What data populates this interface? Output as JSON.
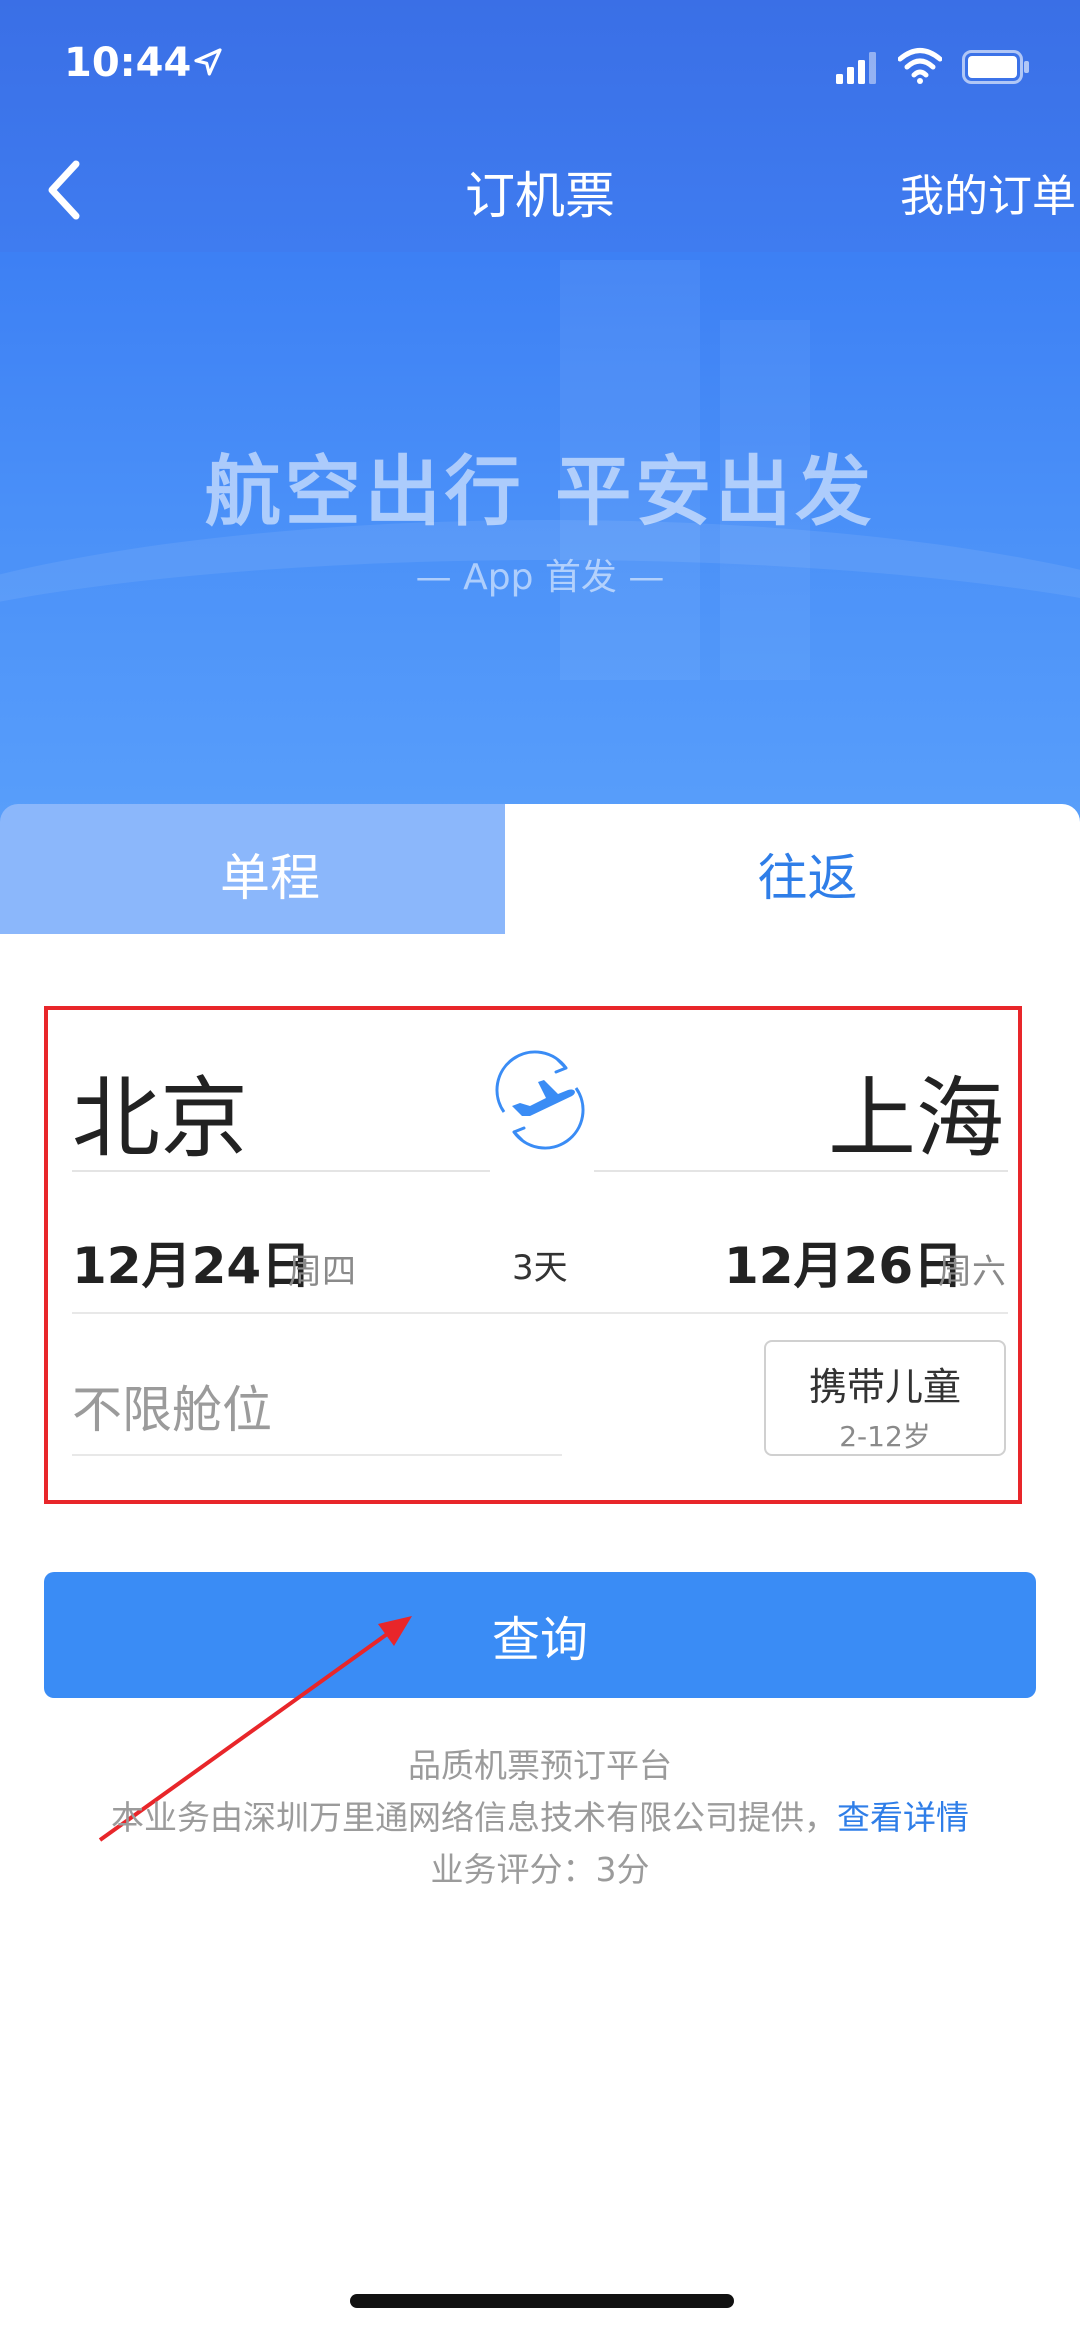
{
  "status_bar": {
    "time": "10:44"
  },
  "nav": {
    "title": "订机票",
    "my_orders": "我的订单"
  },
  "banner": {
    "slogan": "航空出行 平安出发",
    "sub": "— App 首发 —"
  },
  "tabs": [
    {
      "label": "单程",
      "selected": false
    },
    {
      "label": "往返",
      "selected": true
    }
  ],
  "form": {
    "from_city": "北京",
    "to_city": "上海",
    "depart_date": "12月24日",
    "depart_weekday": "周四",
    "trip_days": "3天",
    "return_date": "12月26日",
    "return_weekday": "周六",
    "cabin_placeholder": "不限舱位",
    "child_title": "携带儿童",
    "child_sub": "2-12岁"
  },
  "search_button": "查询",
  "footer": {
    "line1": "品质机票预订平台",
    "line2": "本业务由深圳万里通网络信息技术有限公司提供，",
    "detail_link": "查看详情",
    "line3": "业务评分：3分"
  },
  "colors": {
    "primary": "#3a8cf5",
    "tab_inactive": "#8bb7fb",
    "highlight_box": "#e8262a",
    "link": "#2f7ee8"
  }
}
